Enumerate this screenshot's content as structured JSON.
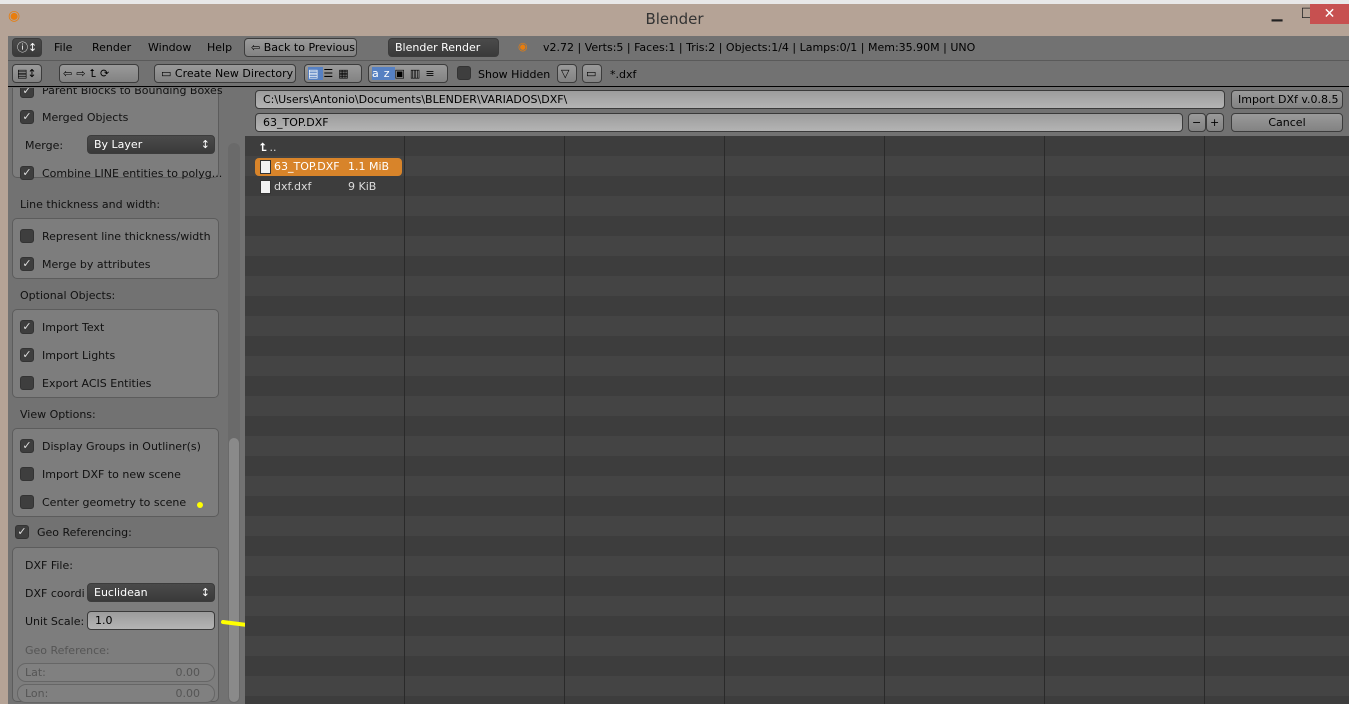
{
  "window": {
    "title": "Blender",
    "minimize": "▁",
    "maximize": "☐",
    "close": "✕"
  },
  "header": {
    "menus": [
      "File",
      "Render",
      "Window",
      "Help"
    ],
    "back": "Back to Previous",
    "engine": "Blender Render",
    "stats": "v2.72 | Verts:5 | Faces:1 | Tris:2 | Objects:1/4 | Lamps:0/1 | Mem:35.90M | UNO"
  },
  "toolbar": {
    "create_dir": "Create New Directory",
    "show_hidden": "Show Hidden",
    "filter": "*.dxf"
  },
  "path": {
    "directory": "C:\\Users\\Antonio\\Documents\\BLENDER\\VARIADOS\\DXF\\",
    "filename": "63_TOP.DXF",
    "import": "Import DXf v.0.8.5",
    "cancel": "Cancel",
    "minus": "−",
    "plus": "+"
  },
  "files": [
    {
      "name": "..",
      "size": ""
    },
    {
      "name": "63_TOP.DXF",
      "size": "1.1 MiB",
      "selected": true
    },
    {
      "name": "dxf.dxf",
      "size": "9 KiB"
    }
  ],
  "options": {
    "parent_blocks": "Parent Blocks to Bounding Boxes",
    "merged_objects": "Merged Objects",
    "merge_label": "Merge:",
    "merge_value": "By Layer",
    "combine": "Combine LINE entities to polyg...",
    "line_section": "Line thickness and width:",
    "represent": "Represent line thickness/width",
    "merge_attr": "Merge by attributes",
    "optional_section": "Optional Objects:",
    "import_text": "Import Text",
    "import_lights": "Import Lights",
    "export_acis": "Export ACIS Entities",
    "view_section": "View Options:",
    "display_groups": "Display Groups in Outliner(s)",
    "new_scene": "Import DXF to new scene",
    "center_geo": "Center geometry to scene",
    "geo_ref": "Geo Referencing:",
    "dxf_file": "DXF File:",
    "dxf_coord_label": "DXF coordi",
    "dxf_coord_value": "Euclidean",
    "unit_scale_label": "Unit Scale:",
    "unit_scale_value": "1.0",
    "geo_reference": "Geo Reference:",
    "lat_label": "Lat:",
    "lat_value": "0.00",
    "lon_label": "Lon:",
    "lon_value": "0.00"
  }
}
